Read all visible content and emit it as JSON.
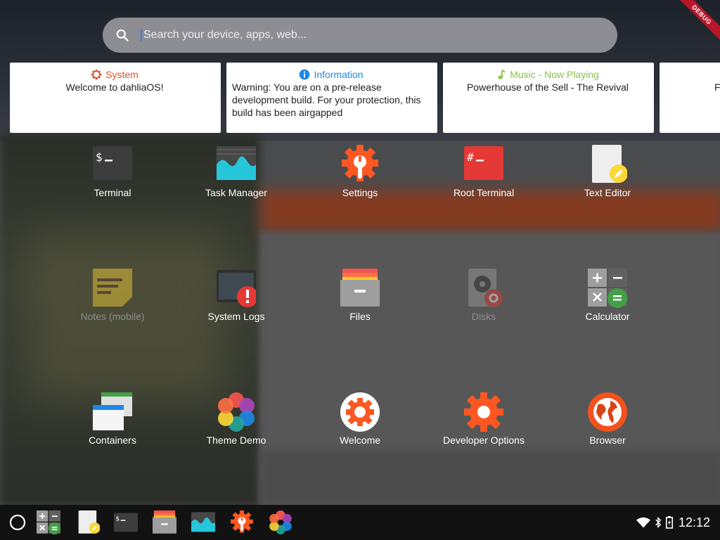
{
  "debug_label": "DEBUG",
  "search": {
    "placeholder": "Search your device, apps, web..."
  },
  "cards": [
    {
      "title": "System",
      "title_color": "#e8502a",
      "icon": "gear-icon",
      "body": "Welcome to dahliaOS!"
    },
    {
      "title": "Information",
      "title_color": "#1e88e5",
      "icon": "info-icon",
      "body": "Warning: You are on a pre-release development build. For your protection, this build has been airgapped"
    },
    {
      "title": "Music - Now Playing",
      "title_color": "#8bc34a",
      "icon": "music-note-icon",
      "body": "Powerhouse of the Sell - The Revival"
    },
    {
      "title": "",
      "title_color": "#000000",
      "icon": "",
      "body": "F"
    }
  ],
  "apps": [
    {
      "label": "Terminal",
      "icon": "terminal-icon",
      "enabled": true
    },
    {
      "label": "Task Manager",
      "icon": "task-manager-icon",
      "enabled": true
    },
    {
      "label": "Settings",
      "icon": "settings-icon",
      "enabled": true
    },
    {
      "label": "Root Terminal",
      "icon": "root-terminal-icon",
      "enabled": true
    },
    {
      "label": "Text Editor",
      "icon": "text-editor-icon",
      "enabled": true
    },
    {
      "label": "Notes (mobile)",
      "icon": "notes-icon",
      "enabled": false
    },
    {
      "label": "System Logs",
      "icon": "system-logs-icon",
      "enabled": true
    },
    {
      "label": "Files",
      "icon": "files-icon",
      "enabled": true
    },
    {
      "label": "Disks",
      "icon": "disks-icon",
      "enabled": false
    },
    {
      "label": "Calculator",
      "icon": "calculator-icon",
      "enabled": true
    },
    {
      "label": "Containers",
      "icon": "containers-icon",
      "enabled": true
    },
    {
      "label": "Theme Demo",
      "icon": "theme-demo-icon",
      "enabled": true
    },
    {
      "label": "Welcome",
      "icon": "welcome-icon",
      "enabled": true
    },
    {
      "label": "Developer Options",
      "icon": "developer-options-icon",
      "enabled": true
    },
    {
      "label": "Browser",
      "icon": "browser-icon",
      "enabled": true
    }
  ],
  "taskbar": {
    "dock": [
      "calculator-icon",
      "text-editor-icon",
      "terminal-icon",
      "files-icon",
      "task-manager-icon",
      "settings-icon",
      "theme-demo-icon"
    ],
    "clock": "12:12"
  },
  "colors": {
    "accent_red": "#ef5350",
    "accent_orange": "#ff5722",
    "taskbar": "#121212"
  }
}
